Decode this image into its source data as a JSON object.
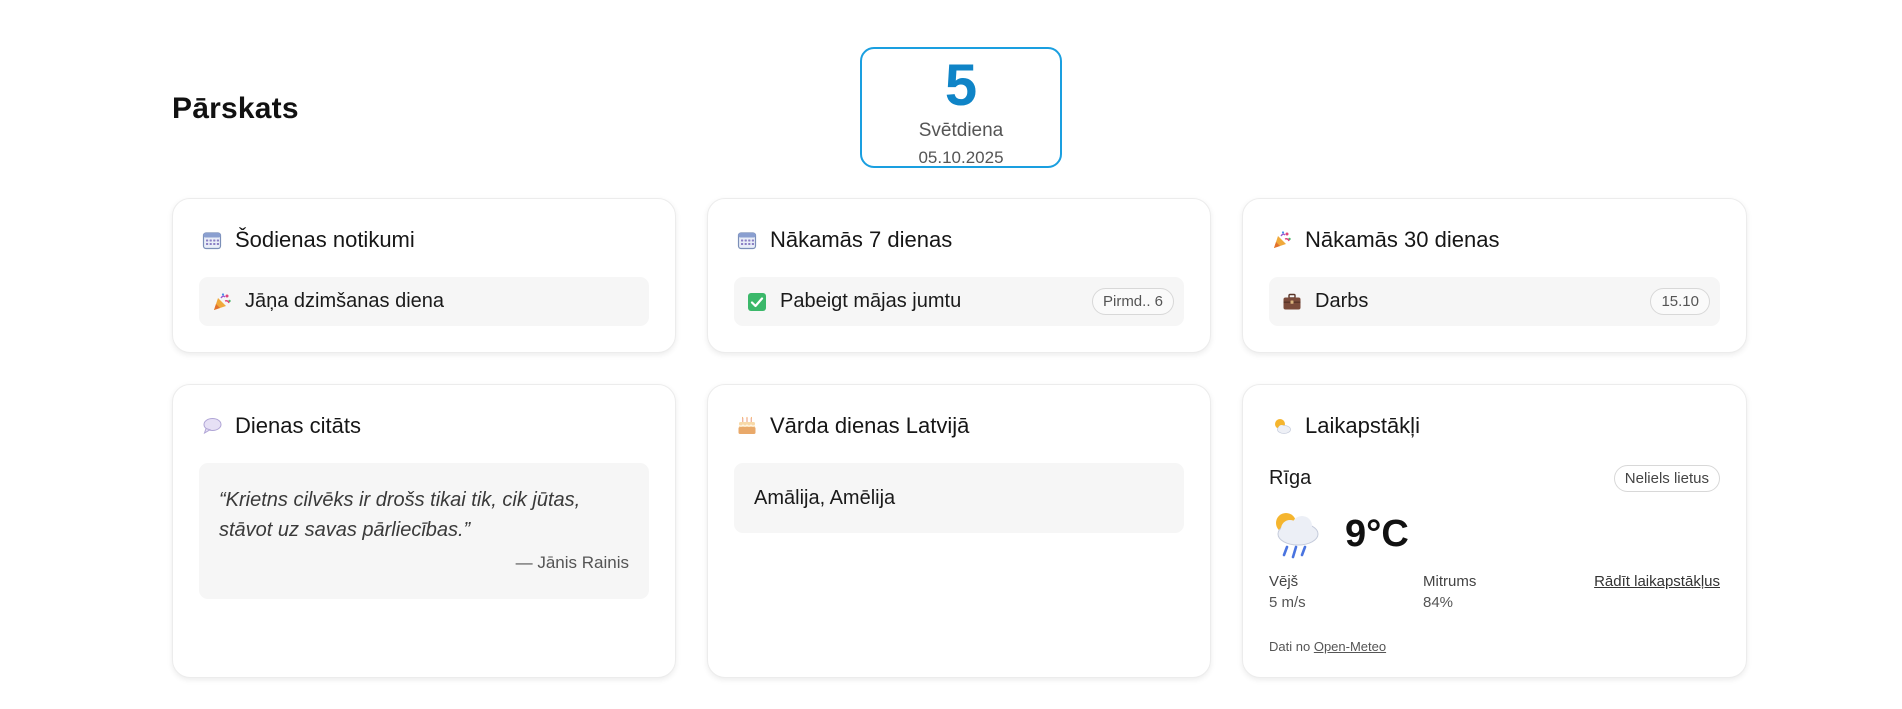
{
  "header": {
    "title": "Pārskats"
  },
  "date": {
    "day": "5",
    "weekday": "Svētdiena",
    "full": "05.10.2025"
  },
  "cards": {
    "today": {
      "title": "Šodienas notikumi",
      "icon": "calendar-icon",
      "item_label": "Jāņa dzimšanas diena",
      "item_icon": "party-popper-icon"
    },
    "next7": {
      "title": "Nākamās 7 dienas",
      "icon": "calendar-icon",
      "item_label": "Pabeigt mājas jumtu",
      "item_icon": "check-mark-icon",
      "item_badge": "Pirmd.. 6"
    },
    "next30": {
      "title": "Nākamās 30 dienas",
      "icon": "party-popper-icon",
      "item_label": "Darbs",
      "item_icon": "briefcase-icon",
      "item_badge": "15.10"
    },
    "quote": {
      "title": "Dienas citāts",
      "icon": "speech-bubble-icon",
      "text": "“Krietns cilvēks ir drošs tikai tik, cik jūtas, stāvot uz savas pārliecības.”",
      "author": "— Jānis Rainis"
    },
    "namedays": {
      "title": "Vārda dienas Latvijā",
      "icon": "cake-icon",
      "names": "Amālija, Amēlija"
    },
    "weather": {
      "title": "Laikapstākļi",
      "icon": "sun-behind-cloud-icon",
      "city": "Rīga",
      "condition": "Neliels lietus",
      "condition_icon": "rain-cloud-sun-icon",
      "temperature": "9°C",
      "wind_label": "Vējš",
      "wind_value": "5 m/s",
      "humidity_label": "Mitrums",
      "humidity_value": "84%",
      "link_label": "Rādīt laikapstākļus",
      "source_prefix": "Dati no",
      "source_link": "Open-Meteo"
    }
  },
  "colors": {
    "accent": "#0f84c7",
    "accent_border": "#1a9fe0",
    "check_green": "#3bb86a",
    "briefcase": "#7a4a3a"
  }
}
